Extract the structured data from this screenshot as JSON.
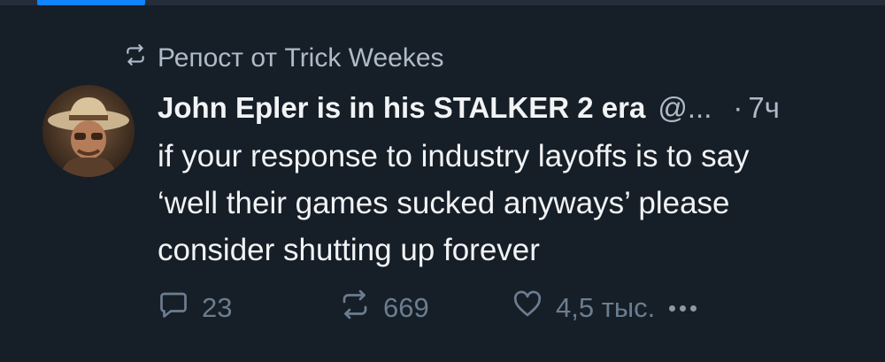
{
  "repost": {
    "label": "Репост от Trick Weekes",
    "icon": "repost-icon"
  },
  "post": {
    "author": "John Epler is in his STALKER 2 era",
    "handle": "@...",
    "separator": "·",
    "time": "7ч",
    "text_lines": [
      "if your response to industry layoffs is to say",
      "‘well their games sucked anyways’ please",
      "consider shutting up forever"
    ]
  },
  "actions": {
    "replies": "23",
    "reposts": "669",
    "likes": "4,5 тыс."
  },
  "colors": {
    "background": "#161e27",
    "accent": "#1083fe",
    "text_primary": "#f1f3f5",
    "text_secondary": "#aebbc9",
    "icon_muted": "#6b7d90"
  }
}
